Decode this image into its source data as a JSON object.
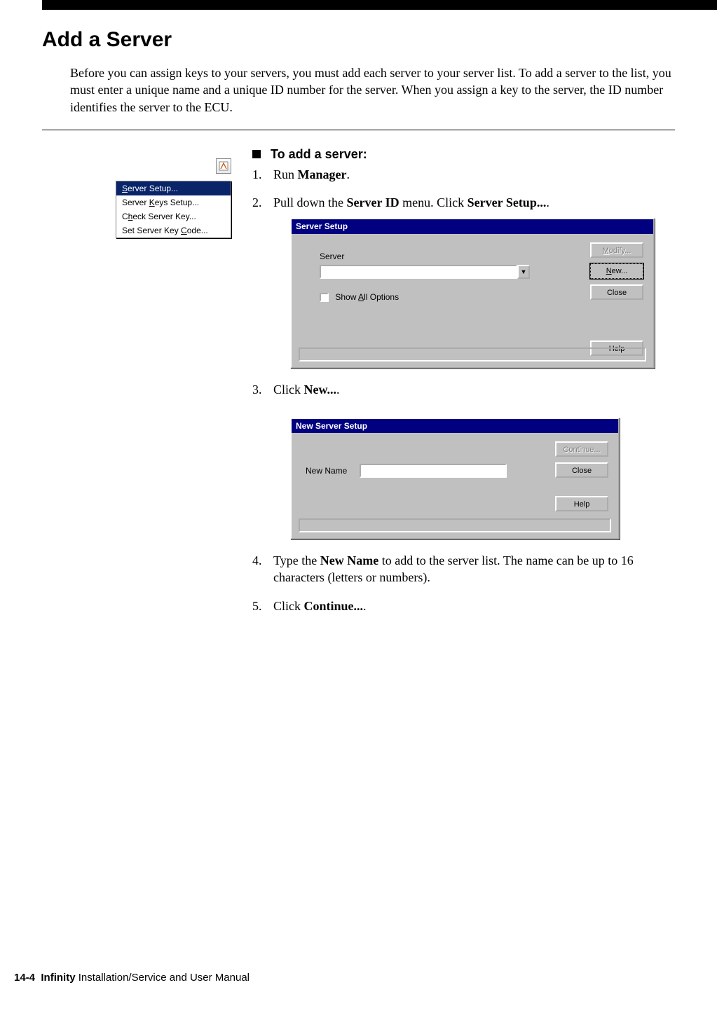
{
  "header": {
    "title": "Add a Server",
    "intro": "Before you can assign keys to your servers, you must add each server to your server list. To add a server to the list, you must enter a unique name and a unique ID number for the server. When you assign a key to the server, the ID number identifies the server to the ECU."
  },
  "procedure": {
    "heading": "To add a server:"
  },
  "steps": {
    "s1_pre": "Run ",
    "s1_bold": "Manager",
    "s1_post": ".",
    "s2_pre": "Pull down the ",
    "s2_b1": "Server ID",
    "s2_mid": " menu. Click ",
    "s2_b2": "Server Setup...",
    "s2_post": ".",
    "s3_pre": "Click ",
    "s3_bold": "New...",
    "s3_post": ".",
    "s4_pre": "Type the ",
    "s4_bold": "New Name",
    "s4_post": " to add to the server list. The name can be up to 16 characters (letters or numbers).",
    "s5_pre": "Click ",
    "s5_bold": "Continue...",
    "s5_post": "."
  },
  "sidebar_menu": {
    "items": [
      {
        "prefix": "S",
        "label": "erver Setup...",
        "highlight": true
      },
      {
        "prefix": "Server ",
        "ul": "K",
        "suffix": "eys Setup..."
      },
      {
        "prefix": "C",
        "ul": "h",
        "suffix": "eck Server Key..."
      },
      {
        "prefix": "Set Server Key ",
        "ul": "C",
        "suffix": "ode..."
      }
    ]
  },
  "dialog1": {
    "title": "Server Setup",
    "server_label": "Server",
    "show_all_prefix": "Show ",
    "show_all_ul": "A",
    "show_all_suffix": "ll Options",
    "buttons": {
      "modify_ul": "M",
      "modify_rest": "odify...",
      "new_ul": "N",
      "new_rest": "ew...",
      "close": "Close",
      "help": "Help"
    }
  },
  "dialog2": {
    "title": "New Server Setup",
    "new_name_label": "New Name",
    "buttons": {
      "continue": "Continue...",
      "close": "Close",
      "help": "Help"
    }
  },
  "footer": {
    "page": "14-4",
    "product": "Infinity",
    "rest": " Installation/Service and User Manual"
  }
}
